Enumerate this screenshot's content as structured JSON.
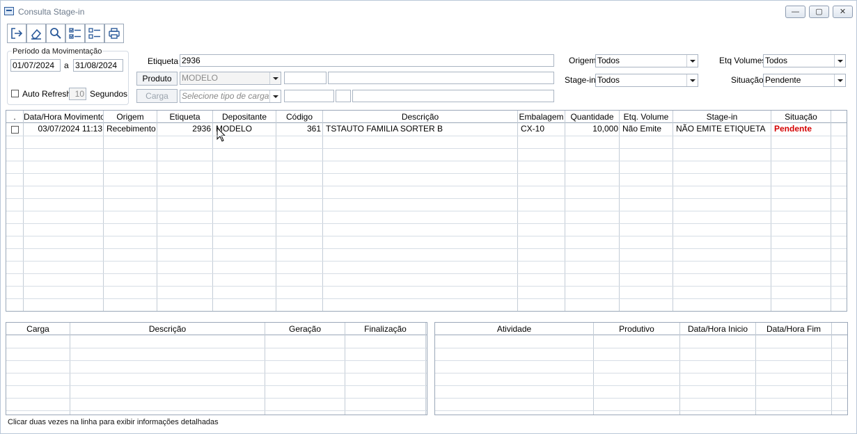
{
  "window": {
    "title": "Consulta Stage-in",
    "min": "—",
    "max": "▢",
    "close": "✕"
  },
  "toolbar": {
    "icons": [
      "exit-icon",
      "eraser-icon",
      "search-icon",
      "checklist-icon",
      "uncheck-list-icon",
      "print-icon"
    ]
  },
  "periodo": {
    "legend": "Período da Movimentação",
    "from": "01/07/2024",
    "sep": "a",
    "to": "31/08/2024"
  },
  "refresh": {
    "label": "Auto Refresh",
    "value": "10",
    "unit": "Segundos"
  },
  "filters": {
    "etiqueta_label": "Etiqueta",
    "etiqueta_value": "2936",
    "produto_button": "Produto",
    "produto_value": "MODELO",
    "carga_button": "Carga",
    "carga_placeholder": "Selecione tipo de carga",
    "origem_label": "Origem",
    "origem_value": "Todos",
    "stagein_label": "Stage-in",
    "stagein_value": "Todos",
    "etqvol_label": "Etq Volumes",
    "etqvol_value": "Todos",
    "situacao_label": "Situação",
    "situacao_value": "Pendente"
  },
  "main_grid": {
    "columns": [
      ".",
      "Data/Hora Movimento",
      "Origem",
      "Etiqueta",
      "Depositante",
      "Código",
      "Descrição",
      "Embalagem",
      "Quantidade",
      "Etq. Volume",
      "Stage-in",
      "Situação"
    ],
    "rows": [
      {
        "data_hora": "03/07/2024 11:13",
        "origem": "Recebimento",
        "etiqueta": "2936",
        "depositante": "MODELO",
        "codigo": "361",
        "descricao": "TSTAUTO FAMILIA SORTER B",
        "embalagem": "CX-10",
        "quantidade": "10,000",
        "etq_volume": "Não Emite",
        "stage_in": "NÃO EMITE ETIQUETA",
        "situacao": "Pendente"
      }
    ]
  },
  "carga_grid": {
    "columns": [
      "Carga",
      "Descrição",
      "Geração",
      "Finalização"
    ]
  },
  "atividade_grid": {
    "columns": [
      "Atividade",
      "Produtivo",
      "Data/Hora Inicio",
      "Data/Hora Fim"
    ]
  },
  "status_text": "Clicar duas vezes na linha para exibir informações detalhadas",
  "colors": {
    "accent": "#2b5a9a",
    "pending": "#d40000"
  }
}
